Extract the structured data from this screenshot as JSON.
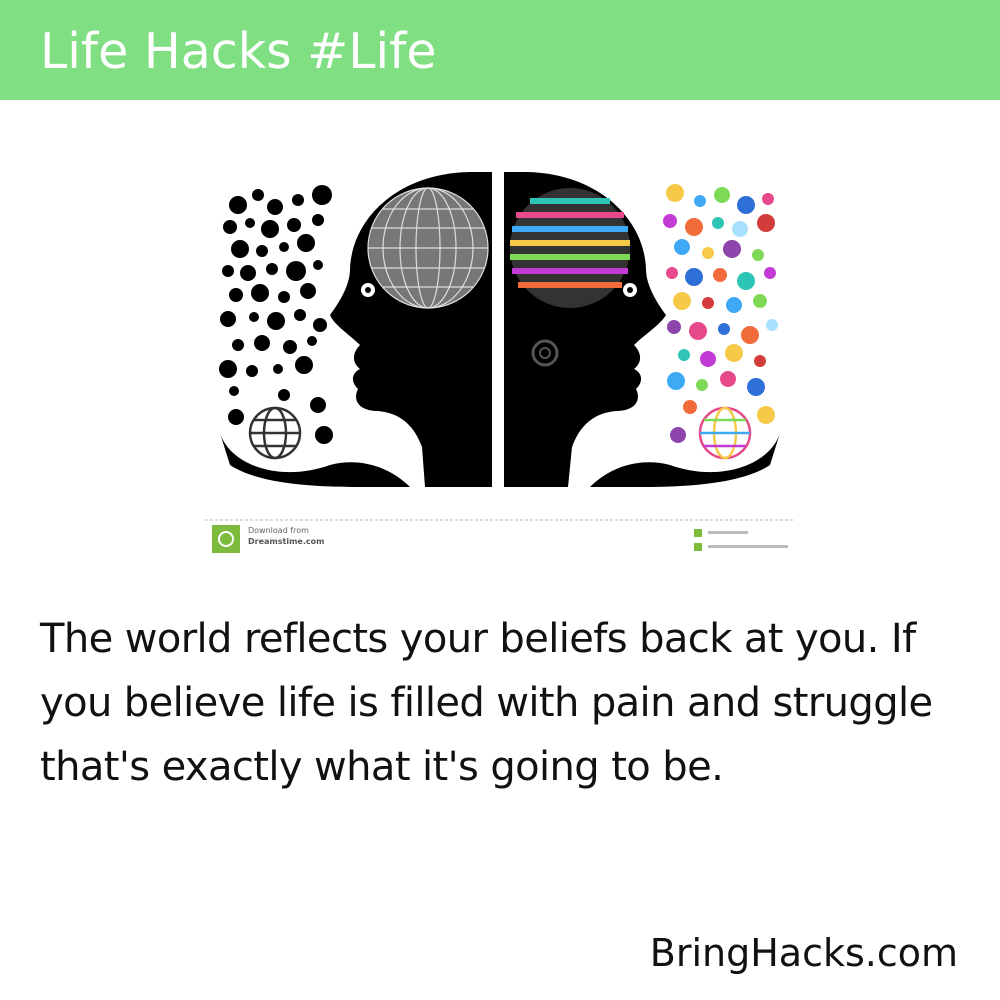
{
  "header": {
    "title": "Life Hacks #Life",
    "background": "#80df83"
  },
  "illustration": {
    "watermark_line1": "Download from",
    "watermark_line2": "Dreamstime.com",
    "left_globe_icon": "globe-icon",
    "right_globe_icon": "colorful-globe-icon"
  },
  "quote": {
    "text": "The world reflects your beliefs back at you. If you believe life is filled with pain and struggle that's exactly what it's going to be."
  },
  "footer": {
    "brand": "BringHacks.com"
  }
}
